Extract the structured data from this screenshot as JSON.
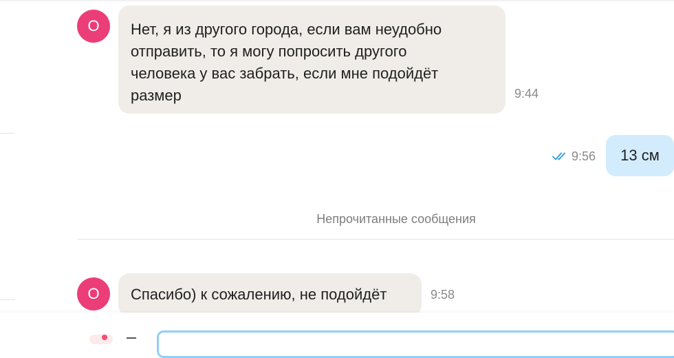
{
  "messages": [
    {
      "avatar_letter": "О",
      "text": "Нет, я из другого города, если вам неудобно\nотправить, то я могу попросить другого\nчеловека у вас забрать, если мне подойдёт\nразмер",
      "time": "9:44"
    },
    {
      "text": "13 см",
      "time": "9:56",
      "status_icon": "double-check-icon"
    },
    {
      "avatar_letter": "О",
      "text": "Спасибо) к сожалению, не подойдёт",
      "time": "9:58"
    }
  ],
  "unread_divider": {
    "label": "Непрочитанные сообщения"
  },
  "composer": {
    "attach_icon": "paperclip-icon",
    "emoji_icon": "emoji-icon",
    "placeholder": ""
  },
  "colors": {
    "avatar": "#eb3e78",
    "incoming_bubble": "#f0ede8",
    "outgoing_bubble": "#d3ecfd",
    "read_check": "#2a9ae6",
    "input_border": "#8fd0f6"
  }
}
